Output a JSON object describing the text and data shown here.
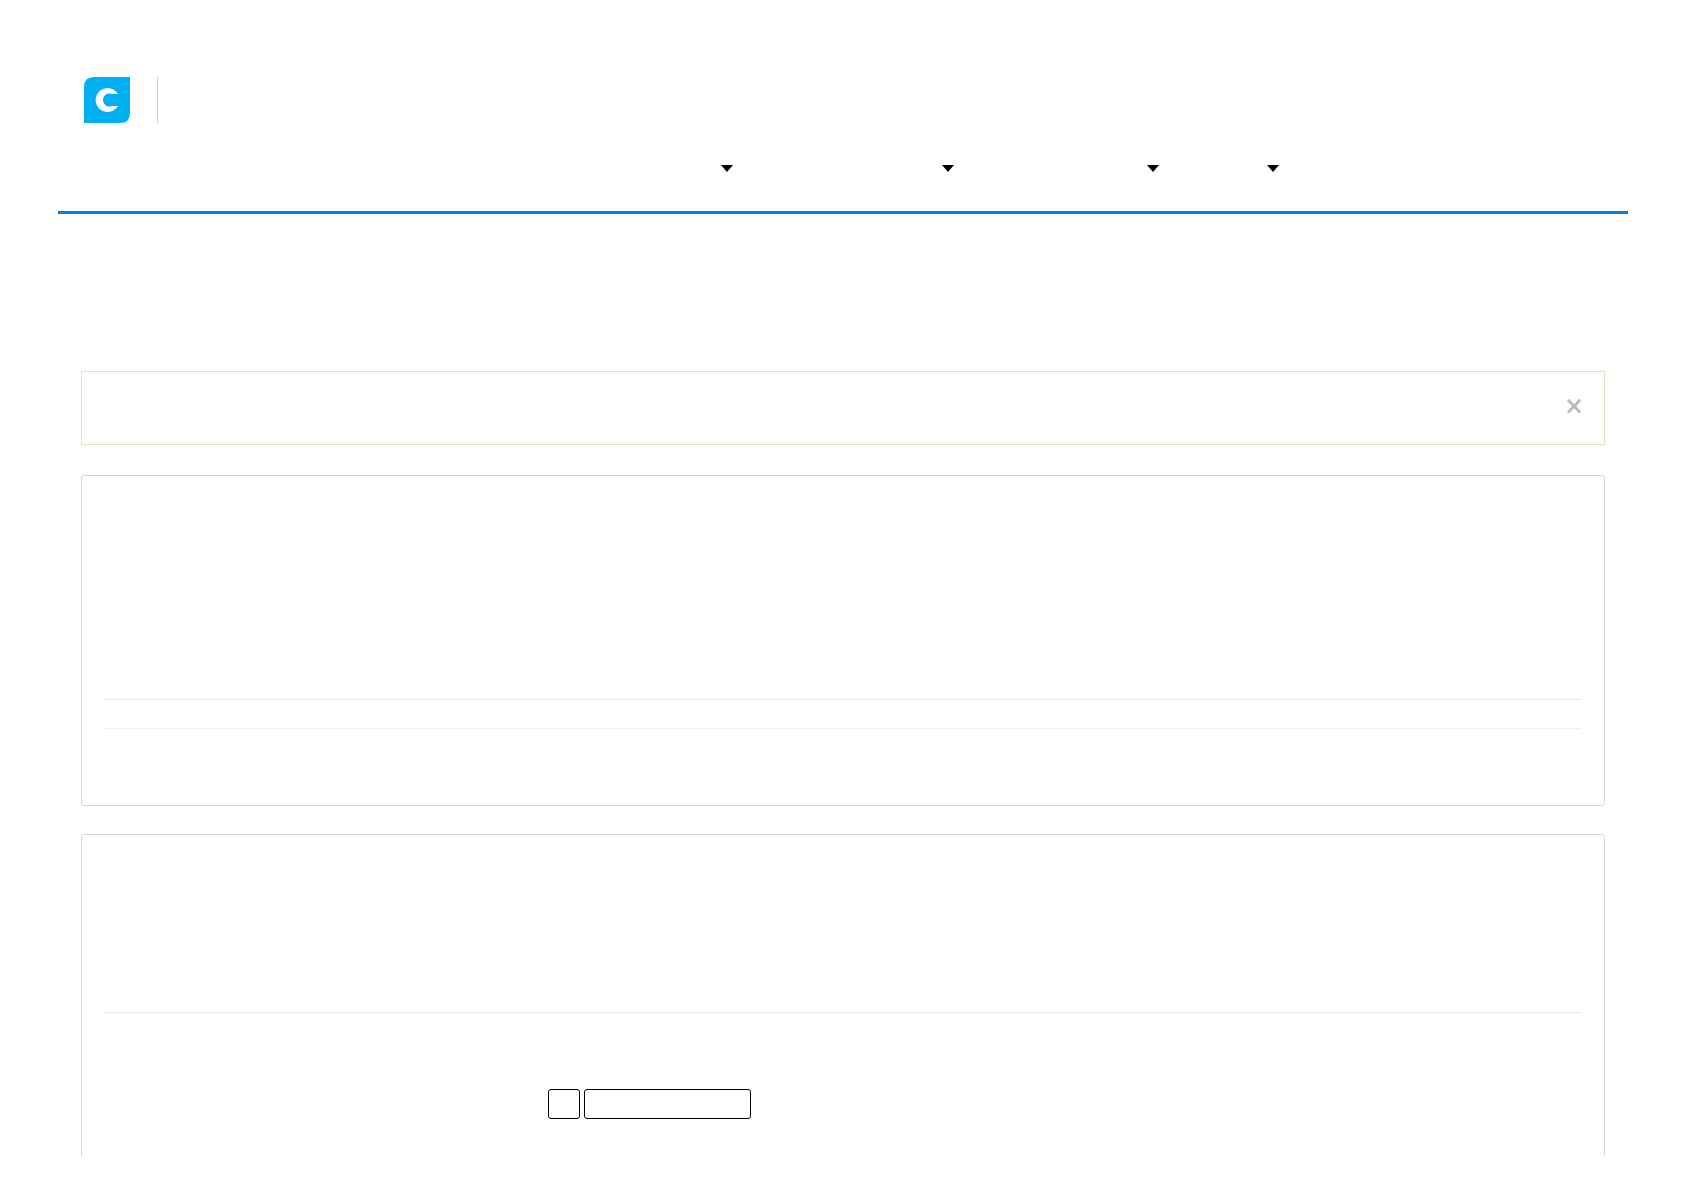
{
  "alert": {
    "close": "×"
  }
}
